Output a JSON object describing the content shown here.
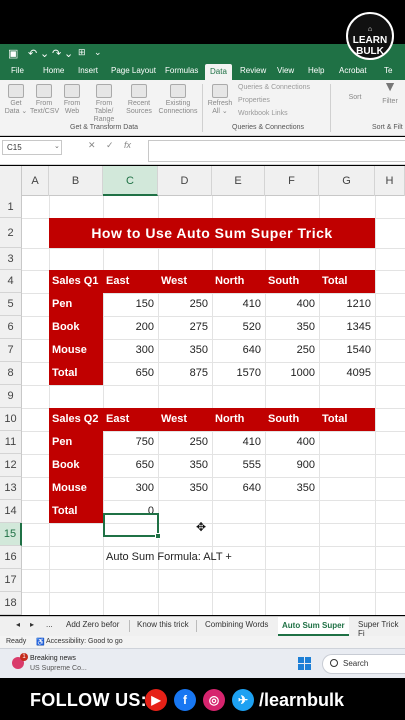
{
  "titlebar": {
    "icons": [
      "save-icon",
      "undo-icon",
      "redo-icon",
      "touch-mode-icon",
      "customize-qat-icon"
    ]
  },
  "tabs": [
    "File",
    "Home",
    "Insert",
    "Page Layout",
    "Formulas",
    "Data",
    "Review",
    "View",
    "Help",
    "Acrobat",
    "Te"
  ],
  "active_tab": "Data",
  "ribbon": {
    "get_data": "Get Data ⌄",
    "from_text": "From Text/CSV",
    "from_web": "From Web",
    "from_table": "From Table/ Range",
    "recent_sources": "Recent Sources",
    "existing_connections": "Existing Connections",
    "group_get_transform": "Get & Transform Data",
    "refresh_all": "Refresh All ⌄",
    "queries_connections": "Queries & Connections",
    "properties": "Properties",
    "workbook_links": "Workbook Links",
    "group_queries": "Queries & Connections",
    "sort": "Sort",
    "filter": "Filter",
    "group_sort": "Sort & Filt"
  },
  "formula_bar": {
    "name_box": "C15",
    "value": ""
  },
  "columns": [
    "A",
    "B",
    "C",
    "D",
    "E",
    "F",
    "G",
    "H"
  ],
  "selected_column": "C",
  "rows": [
    "1",
    "2",
    "3",
    "4",
    "5",
    "6",
    "7",
    "8",
    "9",
    "10",
    "11",
    "12",
    "13",
    "14",
    "15",
    "16",
    "17",
    "18"
  ],
  "selected_row": "15",
  "title": "How to Use Auto Sum Super Trick",
  "table1": {
    "header": [
      "Sales  Q1",
      "East",
      "West",
      "North",
      "South",
      "Total"
    ],
    "rows": [
      [
        "Pen",
        "150",
        "250",
        "410",
        "400",
        "1210"
      ],
      [
        "Book",
        "200",
        "275",
        "520",
        "350",
        "1345"
      ],
      [
        "Mouse",
        "300",
        "350",
        "640",
        "250",
        "1540"
      ],
      [
        "Total",
        "650",
        "875",
        "1570",
        "1000",
        "4095"
      ]
    ]
  },
  "table2": {
    "header": [
      "Sales  Q2",
      "East",
      "West",
      "North",
      "South",
      "Total"
    ],
    "rows": [
      [
        "Pen",
        "750",
        "250",
        "410",
        "400"
      ],
      [
        "Book",
        "650",
        "350",
        "555",
        "900"
      ],
      [
        "Mouse",
        "300",
        "350",
        "640",
        "350"
      ],
      [
        "Total",
        "0"
      ]
    ]
  },
  "formula_note": "Auto Sum Formula:  ALT +",
  "sheet_tabs": [
    "Add Zero befor",
    "Know this trick",
    "Combining Words",
    "Auto Sum Super",
    "Super Trick Fi"
  ],
  "active_sheet": "Auto Sum Super",
  "sheet_nav": {
    "prev": "◂",
    "next": "▸",
    "more": "..."
  },
  "status": {
    "ready": "Ready",
    "accessibility": "Accessibility: Good to go"
  },
  "taskbar": {
    "news_title": "Breaking news",
    "news_sub": "US Supreme Co...",
    "badge": "1",
    "search_placeholder": "Search"
  },
  "branding": {
    "logo_line1": "LEARN",
    "logo_line2": "BULK",
    "follow": "FOLLOW US:",
    "handle": "/learnbulk"
  },
  "colors": {
    "excel_green": "#1f7145",
    "header_red": "#c00000"
  }
}
